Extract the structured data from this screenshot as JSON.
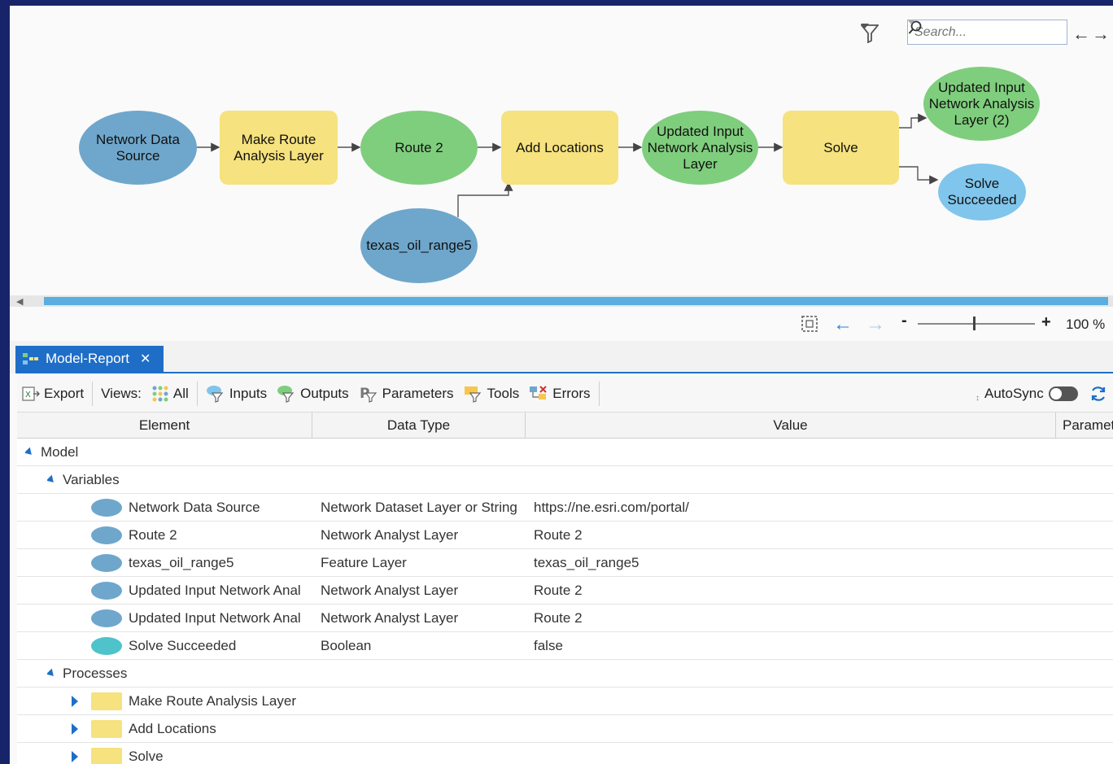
{
  "diagram": {
    "nodes": {
      "network_data_source": "Network Data Source",
      "make_route": "Make Route Analysis Layer",
      "route2": "Route 2",
      "add_locations": "Add Locations",
      "updated_input": "Updated Input Network Analysis Layer",
      "solve": "Solve",
      "updated_input2": "Updated Input Network Analysis Layer (2)",
      "solve_succeeded": "Solve Succeeded",
      "texas": "texas_oil_range5"
    },
    "colors": {
      "data_var": "#6fa7cc",
      "derived": "#7fce7d",
      "tool": "#f6e27e",
      "boolean": "#80c5ec"
    }
  },
  "search": {
    "placeholder": "Search..."
  },
  "zoom": {
    "minus": "-",
    "plus": "+",
    "level": "100 %"
  },
  "tab": {
    "label": "Model-Report"
  },
  "toolbar": {
    "export": "Export",
    "views": "Views:",
    "all": "All",
    "inputs": "Inputs",
    "outputs": "Outputs",
    "parameters": "Parameters",
    "tools": "Tools",
    "errors": "Errors",
    "autosync": "AutoSync"
  },
  "table": {
    "headers": [
      "Element",
      "Data Type",
      "Value",
      "Paramet"
    ],
    "model_label": "Model",
    "variables_label": "Variables",
    "variables": [
      {
        "name": "Network Data Source",
        "type": "Network Dataset Layer or String",
        "value": "https://ne.esri.com/portal/"
      },
      {
        "name": "Route 2",
        "type": "Network Analyst Layer",
        "value": "Route 2"
      },
      {
        "name": "texas_oil_range5",
        "type": "Feature Layer",
        "value": "texas_oil_range5"
      },
      {
        "name": "Updated Input Network Anal",
        "type": "Network Analyst Layer",
        "value": "Route 2"
      },
      {
        "name": "Updated Input Network Anal",
        "type": "Network Analyst Layer",
        "value": "Route 2"
      },
      {
        "name": "Solve Succeeded",
        "type": "Boolean",
        "value": "false"
      }
    ],
    "processes_label": "Processes",
    "processes": [
      "Make Route Analysis Layer",
      "Add Locations",
      "Solve"
    ]
  }
}
